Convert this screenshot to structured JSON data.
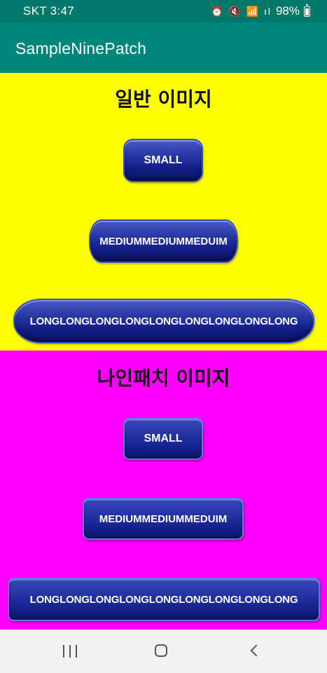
{
  "status_bar": {
    "carrier_time": "SKT 3:47",
    "icons": "⏰ 🔇 📶 ıl",
    "battery": "98%"
  },
  "app_bar": {
    "title": "SampleNinePatch"
  },
  "normal_section": {
    "title": "일반 이미지",
    "small_label": "SMALL",
    "medium_label": "MEDIUMMEDIUMMEDUIM",
    "long_label": "LONGLONGLONGLONGLONGLONGLONGLONGLONG"
  },
  "ninepatch_section": {
    "title": "나인패치 이미지",
    "small_label": "SMALL",
    "medium_label": "MEDIUMMEDIUMMEDUIM",
    "long_label": "LONGLONGLONGLONGLONGLONGLONGLONGLONG"
  },
  "nav_bar": {
    "recent_icon": "recent-apps-icon",
    "home_icon": "home-icon",
    "back_icon": "back-icon"
  },
  "colors": {
    "status_bar": "#00796b",
    "app_bar": "#00867a",
    "normal_bg": "#ffff00",
    "ninepatch_bg": "#ff00ff",
    "button": "#1a2596"
  }
}
